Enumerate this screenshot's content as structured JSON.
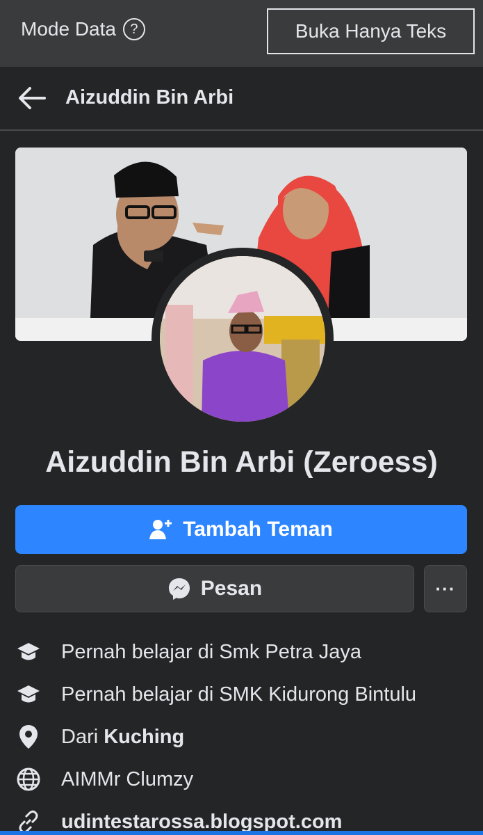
{
  "topbar": {
    "mode_label": "Mode Data",
    "help_icon": "?",
    "text_only_label": "Buka Hanya Teks"
  },
  "header": {
    "title": "Aizuddin Bin Arbi"
  },
  "profile": {
    "name": "Aizuddin Bin Arbi (Zeroess)"
  },
  "actions": {
    "add_friend_label": "Tambah Teman",
    "message_label": "Pesan",
    "more_label": "···"
  },
  "details": [
    {
      "icon": "education-icon",
      "text": "Pernah belajar di Smk Petra Jaya"
    },
    {
      "icon": "education-icon",
      "text": "Pernah belajar di SMK Kidurong Bintulu"
    },
    {
      "icon": "location-icon",
      "prefix": "Dari ",
      "bold": "Kuching"
    },
    {
      "icon": "globe-icon",
      "text": "AIMMr Clumzy"
    },
    {
      "icon": "link-icon",
      "text": "udintestarossa.blogspot.com"
    }
  ],
  "colors": {
    "background": "#242526",
    "topbar": "#3a3b3c",
    "primary_button": "#2d86ff",
    "secondary_button": "#3a3b3c",
    "text": "#e4e6eb"
  }
}
